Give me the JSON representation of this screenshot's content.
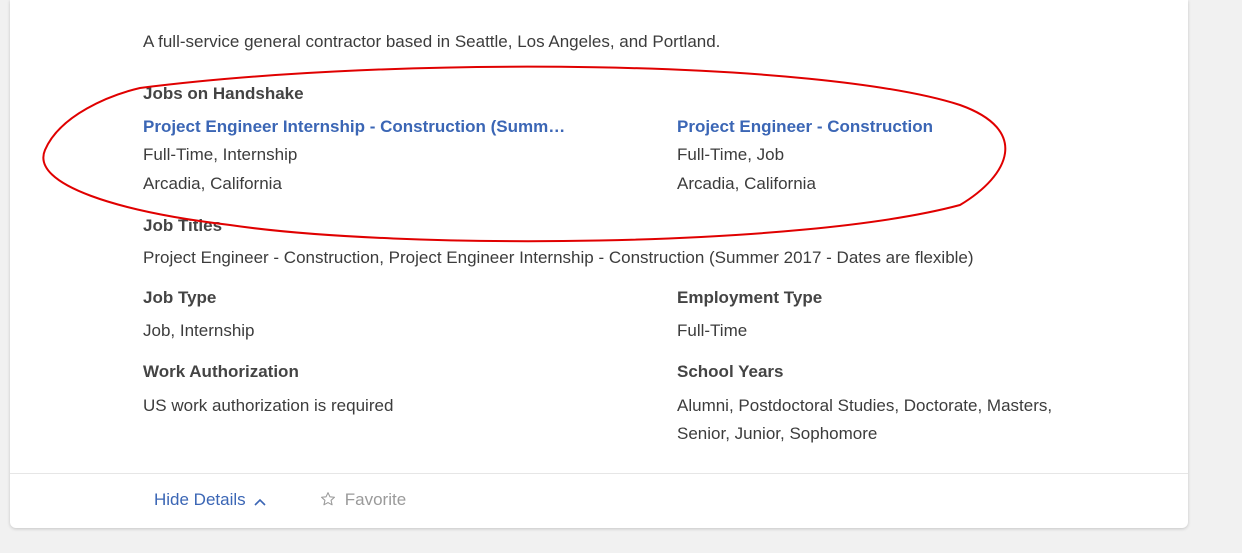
{
  "company": {
    "description": "A full-service general contractor based in Seattle, Los Angeles, and Portland."
  },
  "jobs_on_handshake": {
    "heading": "Jobs on Handshake",
    "jobs": [
      {
        "title": "Project Engineer Internship - Construction (Summ…",
        "type": "Full-Time, Internship",
        "location": "Arcadia, California"
      },
      {
        "title": "Project Engineer - Construction",
        "type": "Full-Time, Job",
        "location": "Arcadia, California"
      }
    ]
  },
  "job_titles": {
    "heading": "Job Titles",
    "value": "Project Engineer - Construction, Project Engineer Internship - Construction (Summer 2017 - Dates are flexible)"
  },
  "job_type": {
    "heading": "Job Type",
    "value": "Job, Internship"
  },
  "employment_type": {
    "heading": "Employment Type",
    "value": "Full-Time"
  },
  "work_authorization": {
    "heading": "Work Authorization",
    "value": "US work authorization is required"
  },
  "school_years": {
    "heading": "School Years",
    "line1": "Alumni, Postdoctoral Studies, Doctorate, Masters,",
    "line2": "Senior, Junior, Sophomore"
  },
  "footer": {
    "hide_details_label": "Hide Details",
    "hide_details_icon": "chevron-up-icon",
    "favorite_label": "Favorite",
    "favorite_icon": "star-outline-icon"
  },
  "colors": {
    "link": "#3b66b5",
    "annotation": "#e00000",
    "background": "#f1f1f1"
  }
}
